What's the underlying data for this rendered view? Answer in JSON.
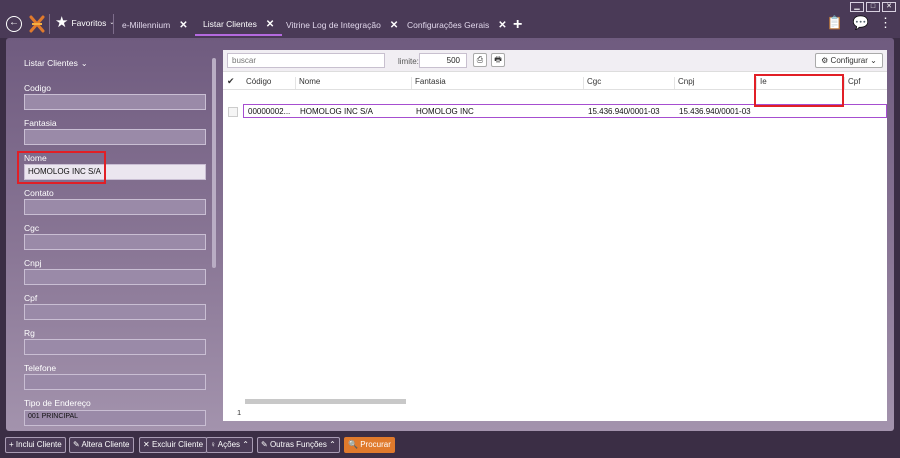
{
  "window": {
    "minimize": "▁",
    "maximize": "□",
    "close": "✕"
  },
  "favoritos": {
    "label": "Favoritos"
  },
  "tabs": [
    {
      "label": "e-Millennium",
      "active": false
    },
    {
      "label": "Listar Clientes",
      "active": true
    },
    {
      "label": "Vitrine Log de Integração",
      "active": false
    },
    {
      "label": "Configurações Gerais",
      "active": false
    }
  ],
  "left_panel": {
    "title": "Listar Clientes",
    "fields": [
      {
        "label": "Codigo",
        "value": ""
      },
      {
        "label": "Fantasia",
        "value": ""
      },
      {
        "label": "Nome",
        "value": "HOMOLOG INC S/A"
      },
      {
        "label": "Contato",
        "value": ""
      },
      {
        "label": "Cgc",
        "value": ""
      },
      {
        "label": "Cnpj",
        "value": ""
      },
      {
        "label": "Cpf",
        "value": ""
      },
      {
        "label": "Rg",
        "value": ""
      },
      {
        "label": "Telefone",
        "value": ""
      },
      {
        "label": "Tipo de Endereço",
        "value": "001 PRINCIPAL"
      }
    ]
  },
  "toolbar": {
    "search_placeholder": "buscar",
    "limite_label": "limite:",
    "limite_value": "500",
    "configurar_label": "Configurar"
  },
  "table": {
    "columns": [
      "Código",
      "Nome",
      "Fantasia",
      "Cgc",
      "Cnpj",
      "Ie",
      "Cpf"
    ],
    "rows": [
      {
        "codigo": "00000002...",
        "nome": "HOMOLOG INC S/A",
        "fantasia": "HOMOLOG INC",
        "cgc": "15.436.940/0001-03",
        "cnpj": "15.436.940/0001-03",
        "ie": "",
        "cpf": ""
      }
    ],
    "count": "1"
  },
  "bottom_bar": {
    "inclui": "Inclui Cliente",
    "altera": "Altera Cliente",
    "exclui": "Excluir Cliente",
    "acoes": "Ações",
    "outras": "Outras Funções",
    "procurar": "Procurar"
  },
  "colors": {
    "accent": "#b56ae0",
    "highlight": "#e11f26",
    "primary_button": "#e07a2c"
  }
}
